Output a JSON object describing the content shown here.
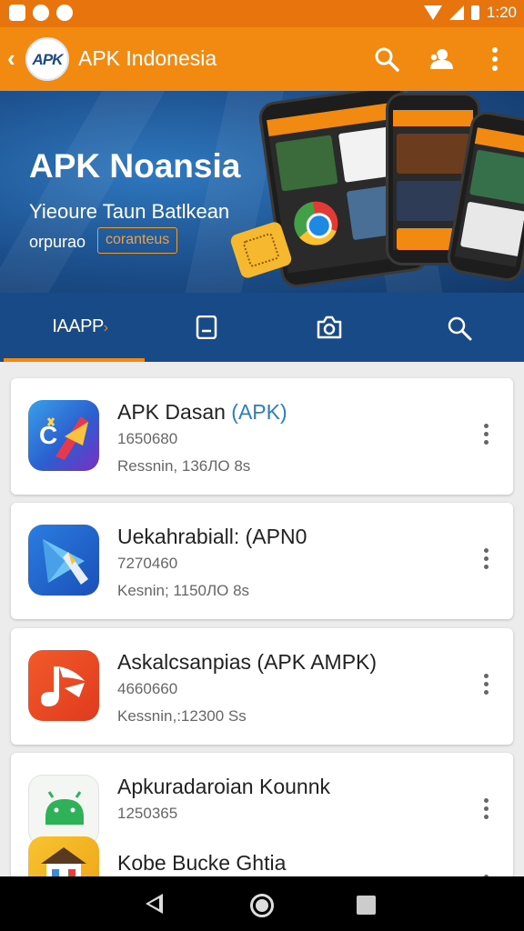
{
  "status_bar": {
    "time": "1:20",
    "notification_icons": [
      "photo-icon",
      "game-icon",
      "app-icon"
    ],
    "system_icons": [
      "wifi-icon",
      "signal-icon",
      "battery-icon"
    ]
  },
  "app_bar": {
    "logo_text": "APK",
    "title": "APK Indonesia",
    "actions": [
      "search-icon",
      "account-icon",
      "more-vertical-icon"
    ]
  },
  "banner": {
    "title": "APK Noansia",
    "subtitle": "Yieoure Taun Batlkean",
    "small_text": "orpurao",
    "chip_label": "coranteus"
  },
  "tabs": [
    {
      "label": "IAAPP",
      "icon": "chevron-right-icon",
      "active": true
    },
    {
      "label": "",
      "icon": "phone-icon",
      "active": false
    },
    {
      "label": "",
      "icon": "camera-icon",
      "active": false
    },
    {
      "label": "",
      "icon": "search-icon",
      "active": false
    }
  ],
  "apps": [
    {
      "title": "APK Dasan",
      "title_accent": "(APK)",
      "number": "1650680",
      "meta": "Ressnin, 136ЛО 8s",
      "icon": "c-arrow-app-icon"
    },
    {
      "title": "Uekahrabiall: (APN0",
      "title_accent": "",
      "number": "7270460",
      "meta": "Kesnin; 1150ЛО 8s",
      "icon": "play-triangle-app-icon"
    },
    {
      "title": "Askalcsanpias (APK AMPK)",
      "title_accent": "",
      "number": "4660660",
      "meta": "Kessnin,:12300 Ss",
      "icon": "music-note-app-icon"
    },
    {
      "title": "Apkuradaroian Kounnk",
      "title_accent": "",
      "number": "1250365",
      "meta": "",
      "icon": "android-app-icon"
    },
    {
      "title": "Kobe Bucke Ghtia",
      "title_accent": "",
      "number": "",
      "meta": "",
      "icon": "house-app-icon"
    }
  ],
  "nav_bar": {
    "buttons": [
      "back-icon",
      "home-icon",
      "recents-icon"
    ]
  },
  "colors": {
    "primary": "#f28a12",
    "status_bar": "#e8740e",
    "tab_bar": "#174a86",
    "accent_link": "#2a7fc4",
    "background": "#ececec"
  }
}
